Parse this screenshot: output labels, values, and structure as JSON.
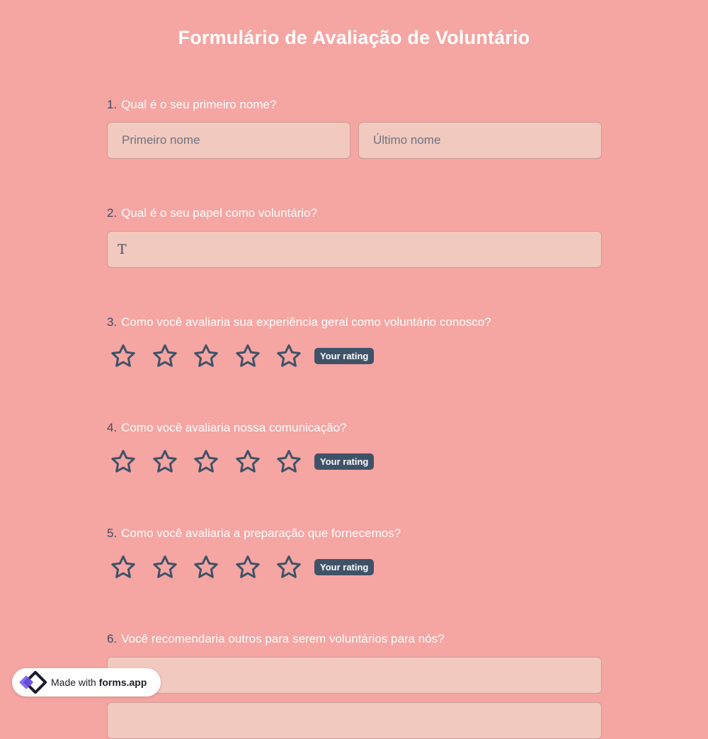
{
  "form": {
    "title": "Formulário de Avaliação de Voluntário"
  },
  "q1": {
    "number": "1.",
    "label": "Qual é o seu primeiro nome?",
    "first_placeholder": "Primeiro nome",
    "last_placeholder": "Último nome"
  },
  "q2": {
    "number": "2.",
    "label": "Qual é o seu papel como voluntário?",
    "icon": "text-type-icon",
    "icon_glyph": "T"
  },
  "q3": {
    "number": "3.",
    "label": "Como você avaliaria sua experiência geral como voluntário conosco?",
    "rating_badge": "Your rating",
    "max_stars": 5,
    "selected": 0
  },
  "q4": {
    "number": "4.",
    "label": "Como você avaliaria nossa comunicação?",
    "rating_badge": "Your rating",
    "max_stars": 5,
    "selected": 0
  },
  "q5": {
    "number": "5.",
    "label": "Como você avaliaria a preparação que fornecemos?",
    "rating_badge": "Your rating",
    "max_stars": 5,
    "selected": 0
  },
  "q6": {
    "number": "6.",
    "label": "Você recomendaria outros para serem voluntários para nós?"
  },
  "branding": {
    "prefix": "Made with",
    "name": "forms.app",
    "logo_icon": "forms-app-logo-icon"
  },
  "colors": {
    "background": "#f5a5a2",
    "input_background": "#f1c9be",
    "accent": "#3f5268",
    "label_text": "#ffffff"
  }
}
